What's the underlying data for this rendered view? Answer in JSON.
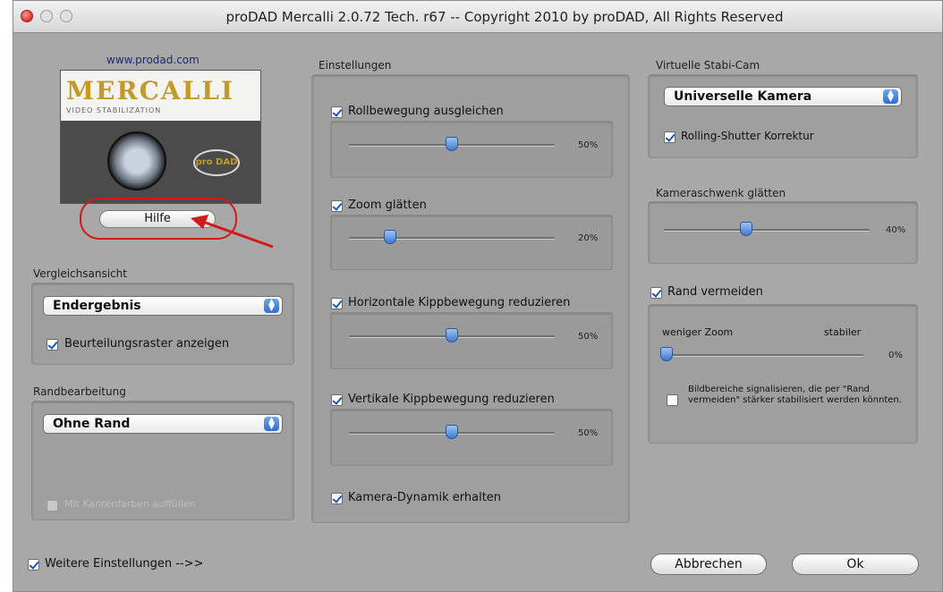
{
  "window": {
    "title": "proDAD Mercalli 2.0.72 Tech. r67 -- Copyright 2010 by proDAD, All Rights Reserved"
  },
  "logo": {
    "site": "www.prodad.com",
    "wordmark": "MERCALLI",
    "subtitle": "VIDEO STABILIZATION",
    "badge": "pro DAD"
  },
  "help_button": "Hilfe",
  "vergleich": {
    "title": "Vergleichsansicht",
    "selected": "Endergebnis",
    "checkbox_label": "Beurteilungsraster anzeigen",
    "checkbox_checked": true
  },
  "rand": {
    "title": "Randbearbeitung",
    "selected": "Ohne Rand",
    "checkbox_label": "Mit Kantenfarben auffüllen",
    "checkbox_enabled": false
  },
  "einstellungen": {
    "title": "Einstellungen",
    "sliders": [
      {
        "label": "Rollbewegung ausgleichen",
        "checked": true,
        "value": 50,
        "value_text": "50%"
      },
      {
        "label": "Zoom glätten",
        "checked": true,
        "value": 20,
        "value_text": "20%"
      },
      {
        "label": "Horizontale Kippbewegung reduzieren",
        "checked": true,
        "value": 50,
        "value_text": "50%"
      },
      {
        "label": "Vertikale Kippbewegung reduzieren",
        "checked": true,
        "value": 50,
        "value_text": "50%"
      }
    ],
    "dynamik_label": "Kamera-Dynamik erhalten",
    "dynamik_checked": true
  },
  "stabicam": {
    "title": "Virtuelle Stabi-Cam",
    "selected": "Universelle Kamera",
    "checkbox_label": "Rolling-Shutter Korrektur",
    "checkbox_checked": true
  },
  "kameraschwenk": {
    "title": "Kameraschwenk glätten",
    "value": 40,
    "value_text": "40%"
  },
  "randvermeiden": {
    "label": "Rand vermeiden",
    "checked": true,
    "left_label": "weniger Zoom",
    "right_label": "stabiler",
    "value": 0,
    "value_text": "0%",
    "signal_label": "Bildbereiche signalisieren, die per \"Rand vermeiden\" stärker stabilisiert werden könnten.",
    "signal_checked": false
  },
  "footer": {
    "more_label": "Weitere Einstellungen -->>",
    "more_checked": true,
    "cancel": "Abbrechen",
    "ok": "Ok"
  },
  "colors": {
    "accent": "#2e6fd0",
    "highlight": "#d11a1a",
    "panel": "#a8a8a8"
  }
}
